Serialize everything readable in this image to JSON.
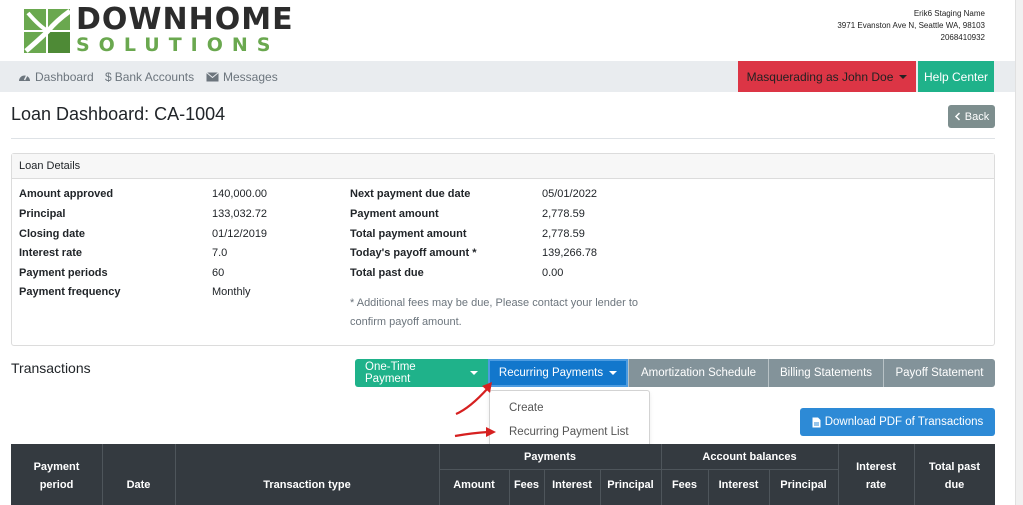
{
  "brand": {
    "line1": "DOWNHOME",
    "line2": "SOLUTIONS",
    "company_name": "Erik6 Staging Name",
    "company_address": "3971 Evanston Ave N, Seattle WA, 98103",
    "company_phone": "2068410932"
  },
  "nav": {
    "dashboard": "Dashboard",
    "bank_accounts": "Bank Accounts",
    "messages": "Messages",
    "masquerading": "Masquerading as John Doe",
    "help_center": "Help Center"
  },
  "page": {
    "title": "Loan Dashboard: CA-1004",
    "back": "Back"
  },
  "loan_details": {
    "header": "Loan Details",
    "left": [
      {
        "label": "Amount approved",
        "value": "140,000.00"
      },
      {
        "label": "Principal",
        "value": "133,032.72"
      },
      {
        "label": "Closing date",
        "value": "01/12/2019"
      },
      {
        "label": "Interest rate",
        "value": "7.0"
      },
      {
        "label": "Payment periods",
        "value": "60"
      },
      {
        "label": "Payment frequency",
        "value": "Monthly"
      }
    ],
    "right": [
      {
        "label": "Next payment due date",
        "value": "05/01/2022"
      },
      {
        "label": "Payment amount",
        "value": "2,778.59"
      },
      {
        "label": "Total payment amount",
        "value": "2,778.59"
      },
      {
        "label": "Today's payoff amount *",
        "value": "139,266.78"
      },
      {
        "label": "Total past due",
        "value": "0.00"
      }
    ],
    "note_line1": "* Additional fees may be due, Please contact your lender to",
    "note_line2": "confirm payoff amount."
  },
  "transactions": {
    "title": "Transactions",
    "buttons": {
      "one_time": "One-Time Payment",
      "recurring": "Recurring Payments",
      "amortization": "Amortization Schedule",
      "billing": "Billing Statements",
      "payoff": "Payoff Statement"
    },
    "dropdown": {
      "create": "Create",
      "list": "Recurring Payment List"
    },
    "download_pdf": "Download PDF of Transactions",
    "table": {
      "payment_period_1": "Payment",
      "payment_period_2": "period",
      "date": "Date",
      "transaction_type": "Transaction type",
      "payments_group": "Payments",
      "account_balances_group": "Account balances",
      "amount": "Amount",
      "fees": "Fees",
      "interest": "Interest",
      "principal": "Principal",
      "bal_fees": "Fees",
      "bal_interest": "Interest",
      "bal_principal": "Principal",
      "interest_rate_1": "Interest",
      "interest_rate_2": "rate",
      "total_past_due_1": "Total past",
      "total_past_due_2": "due"
    }
  },
  "colors": {
    "brand_green": "#6aa84f",
    "masquerade_red": "#dc3545",
    "help_teal": "#1fb28a",
    "active_blue": "#1277cc",
    "table_header": "#343a40",
    "annotation_arrow": "#d62020"
  },
  "icons": [
    "dashboard-icon",
    "dollar-icon",
    "envelope-icon",
    "chevron-left-icon",
    "pdf-file-icon",
    "caret-down-icon"
  ]
}
